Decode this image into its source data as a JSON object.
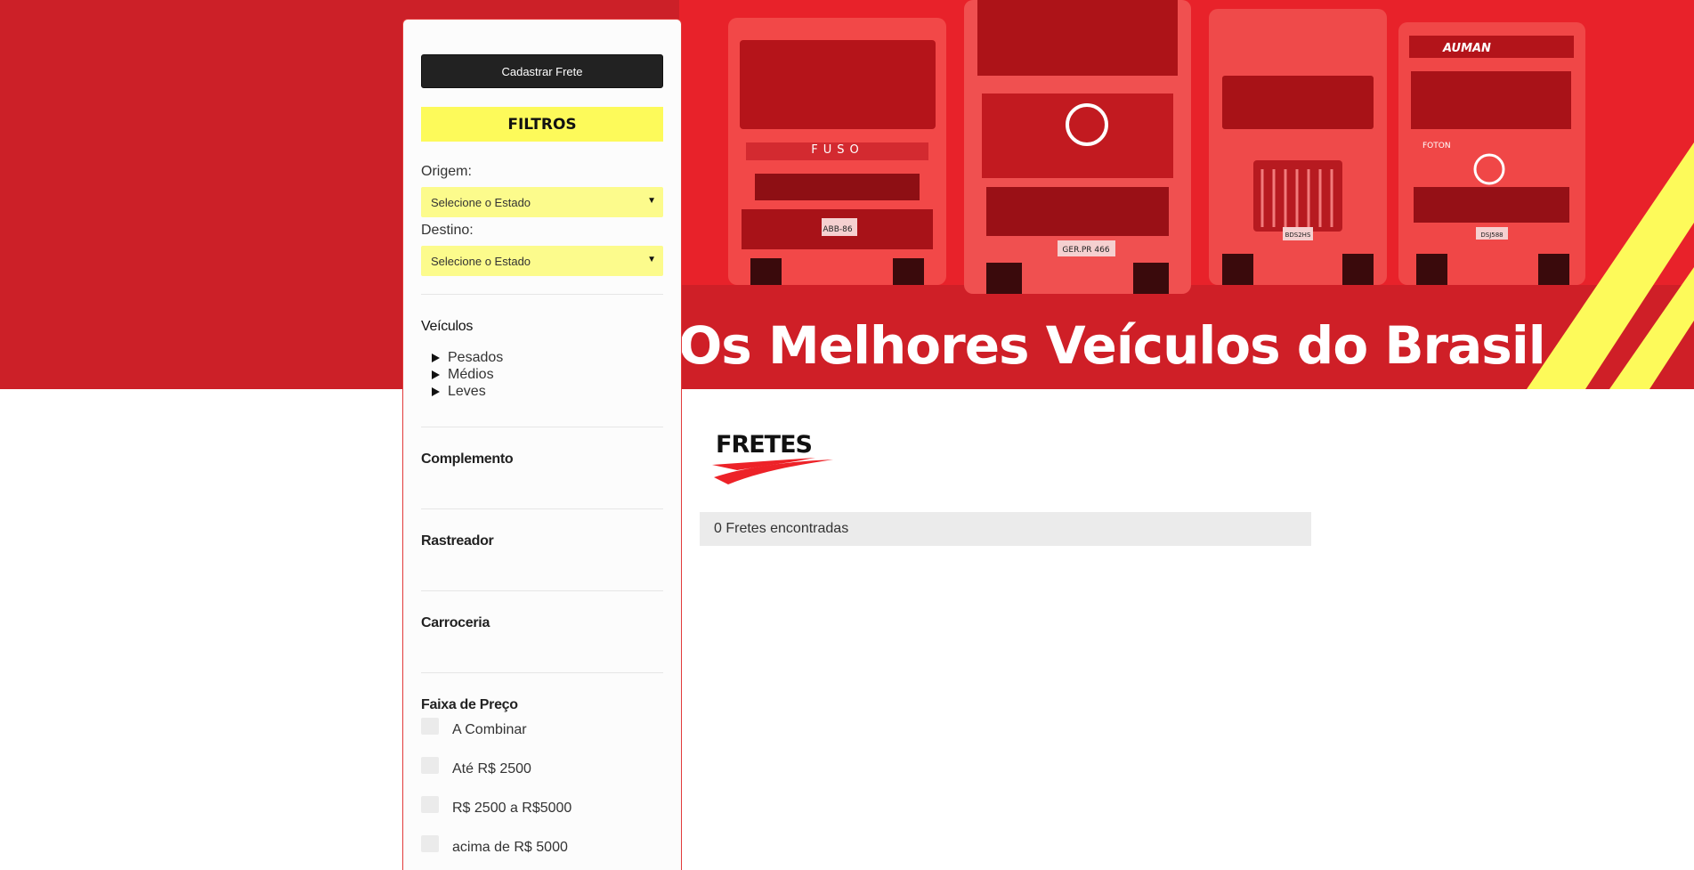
{
  "hero": {
    "title": "Os Melhores Veículos do Brasil",
    "trucks": [
      {
        "brand": "FUSO",
        "plate": "ABB-86"
      },
      {
        "brand": "",
        "plate": "GER.PR 466"
      },
      {
        "brand": "",
        "plate": "BDS2HS"
      },
      {
        "brand": "FOTON",
        "plate": "DSJ588",
        "badge": "AUMAN"
      }
    ],
    "colors": {
      "background": "#cc2028",
      "accent_yellow": "#fdfa5a"
    }
  },
  "sidebar": {
    "register_button": "Cadastrar Frete",
    "filters_title": "FILTROS",
    "origin": {
      "label": "Origem:",
      "value": "Selecione o Estado"
    },
    "destination": {
      "label": "Destino:",
      "value": "Selecione o Estado"
    },
    "vehicles": {
      "title": "Veículos",
      "items": [
        {
          "label": "Pesados"
        },
        {
          "label": "Médios"
        },
        {
          "label": "Leves"
        }
      ]
    },
    "complement_title": "Complemento",
    "tracker_title": "Rastreador",
    "body_title": "Carroceria",
    "price": {
      "title": "Faixa de Preço",
      "options": [
        {
          "label": "A Combinar"
        },
        {
          "label": "Até R$ 2500"
        },
        {
          "label": "R$ 2500 a R$5000"
        },
        {
          "label": "acima de R$ 5000"
        }
      ]
    }
  },
  "main": {
    "section_logo": "FRETES",
    "result_count": "0 Fretes encontradas"
  }
}
